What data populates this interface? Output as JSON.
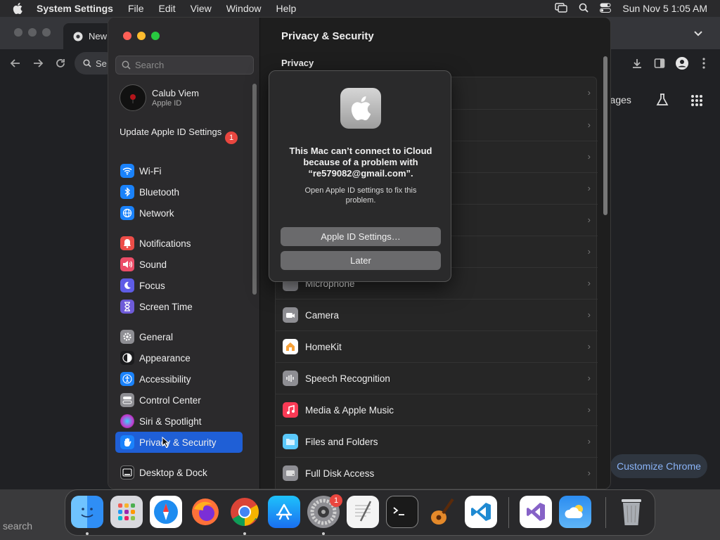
{
  "menubar": {
    "app_name": "System Settings",
    "menus": [
      "File",
      "Edit",
      "View",
      "Window",
      "Help"
    ],
    "clock": "Sun Nov 5  1:05 AM"
  },
  "chrome": {
    "tab_title": "New",
    "address_partial": "Se",
    "images_link": "Images",
    "customize_label": "Customize Chrome"
  },
  "settings": {
    "search_placeholder": "Search",
    "profile": {
      "name": "Calub Viem",
      "subtitle": "Apple ID"
    },
    "update_label": "Update Apple ID Settings",
    "update_badge": "1",
    "sidebar_items": [
      {
        "label": "Wi-Fi",
        "icon": "wifi-icon",
        "color": "#1a82fb"
      },
      {
        "label": "Bluetooth",
        "icon": "bluetooth-icon",
        "color": "#1a82fb"
      },
      {
        "label": "Network",
        "icon": "globe-icon",
        "color": "#1a82fb"
      },
      {
        "label": "Notifications",
        "icon": "bell-icon",
        "color": "#ec4d48"
      },
      {
        "label": "Sound",
        "icon": "speaker-icon",
        "color": "#ec4d68"
      },
      {
        "label": "Focus",
        "icon": "moon-icon",
        "color": "#5e5ce6"
      },
      {
        "label": "Screen Time",
        "icon": "hourglass-icon",
        "color": "#6e5bd8"
      },
      {
        "label": "General",
        "icon": "gear-icon",
        "color": "#8e8e93"
      },
      {
        "label": "Appearance",
        "icon": "appearance-icon",
        "color": "#1c1c1e"
      },
      {
        "label": "Accessibility",
        "icon": "accessibility-icon",
        "color": "#1a82fb"
      },
      {
        "label": "Control Center",
        "icon": "control-center-icon",
        "color": "#8e8e93"
      },
      {
        "label": "Siri & Spotlight",
        "icon": "siri-icon",
        "color": "#c13ccf"
      },
      {
        "label": "Privacy & Security",
        "icon": "hand-icon",
        "color": "#1a82fb"
      },
      {
        "label": "Desktop & Dock",
        "icon": "dock-icon",
        "color": "#1c1c1e"
      }
    ],
    "selected_item": "Privacy & Security",
    "main": {
      "title": "Privacy & Security",
      "section": "Privacy",
      "rows": [
        {
          "label": "Microphone",
          "icon": "microphone-icon",
          "color": "#8e8e93"
        },
        {
          "label": "Camera",
          "icon": "camera-icon",
          "color": "#8e8e93"
        },
        {
          "label": "HomeKit",
          "icon": "home-icon",
          "color": "#f7a23a"
        },
        {
          "label": "Speech Recognition",
          "icon": "waveform-icon",
          "color": "#8e8e93"
        },
        {
          "label": "Media & Apple Music",
          "icon": "music-icon",
          "color": "#fa3a55"
        },
        {
          "label": "Files and Folders",
          "icon": "folder-icon",
          "color": "#5ac8fa"
        },
        {
          "label": "Full Disk Access",
          "icon": "disk-icon",
          "color": "#8e8e93"
        }
      ]
    }
  },
  "dialog": {
    "message": "This Mac can’t connect to iCloud because of a problem with “re579082@gmail.com”.",
    "info": "Open Apple ID settings to fix this problem.",
    "primary_button": "Apple ID Settings…",
    "secondary_button": "Later"
  },
  "dock": {
    "apps": [
      "Finder",
      "Launchpad",
      "Safari",
      "Firefox",
      "Chrome",
      "App Store",
      "System Settings",
      "TextEdit",
      "Terminal",
      "GarageBand",
      "Visual Studio Code",
      "Visual Studio",
      "Weather",
      "Trash"
    ],
    "settings_badge": "1"
  },
  "bottom_search": "search"
}
